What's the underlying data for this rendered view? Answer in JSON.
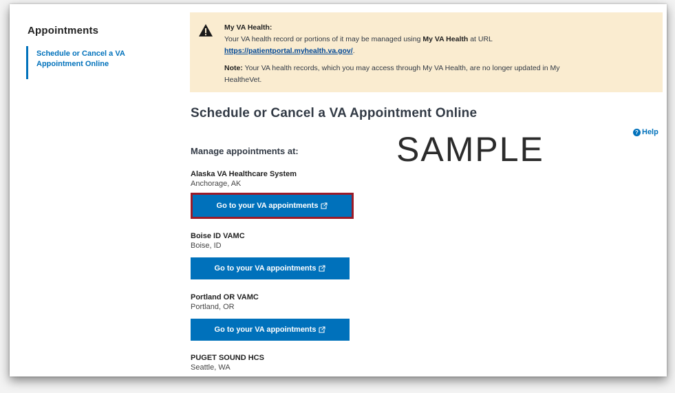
{
  "sidebar": {
    "title": "Appointments",
    "items": [
      {
        "label": "Schedule or Cancel a VA Appointment Online"
      }
    ]
  },
  "alert": {
    "heading": "My VA Health:",
    "text_1": "Your VA health record or portions of it may be managed using ",
    "text_bold": "My VA Health",
    "text_2": " at URL ",
    "link": "https://patientportal.myhealth.va.gov/",
    "text_3": ".",
    "note_label": "Note:",
    "note_text": " Your VA health records, which you may access through My VA Health, are no longer updated in My HealtheVet.",
    "icon": "warning-triangle-icon"
  },
  "main": {
    "title": "Schedule or Cancel a VA Appointment Online",
    "help_label": "Help",
    "watermark": "SAMPLE",
    "manage_label": "Manage appointments at:",
    "facilities": [
      {
        "name": "Alaska VA Healthcare System",
        "location": "Anchorage, AK",
        "button": "Go to your VA appointments",
        "highlighted": true
      },
      {
        "name": "Boise ID VAMC",
        "location": "Boise, ID",
        "button": "Go to your VA appointments"
      },
      {
        "name": "Portland OR VAMC",
        "location": "Portland, OR",
        "button": "Go to your VA appointments"
      },
      {
        "name": "PUGET SOUND HCS",
        "location": "Seattle, WA"
      }
    ]
  },
  "colors": {
    "primary": "#0071bb",
    "alert_bg": "#faecd0",
    "highlight_border": "#9b1b28"
  }
}
